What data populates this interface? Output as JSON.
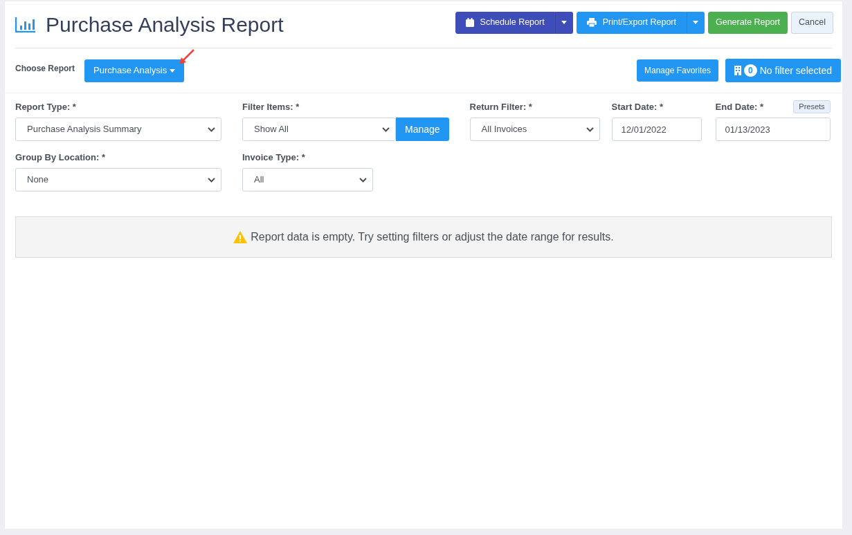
{
  "header": {
    "title": "Purchase Analysis Report",
    "buttons": [
      {
        "label": "Schedule Report",
        "kind": "split"
      },
      {
        "label": "Print/Export Report",
        "kind": "split"
      },
      {
        "label": "Generate Report",
        "kind": "plain"
      },
      {
        "label": "Cancel",
        "kind": "plain"
      }
    ]
  },
  "chooser": {
    "label": "Choose Report",
    "value": "Purchase Analysis",
    "favorites": "Manage Favorites",
    "filter_count": "0",
    "filter_label": "No filter selected"
  },
  "form_rows": [
    [
      {
        "label": "Report Type: *",
        "kind": "select",
        "value": "Purchase Analysis Summary"
      },
      {
        "label": "Filter Items: *",
        "kind": "select",
        "value": "Show All",
        "action": "Manage"
      },
      {
        "label": "Return Filter: *",
        "kind": "select",
        "value": "All Invoices"
      },
      {
        "label": "Start Date: *",
        "kind": "date",
        "value": "12/01/2022"
      },
      {
        "label": "End Date: *",
        "kind": "date",
        "value": "01/13/2023",
        "extra": "Presets"
      }
    ],
    [
      {
        "label": "Group By Location: *",
        "kind": "select",
        "value": "None"
      },
      {
        "label": "Invoice Type: *",
        "kind": "select",
        "value": "All"
      }
    ]
  ],
  "alert": "Report data is empty. Try setting filters or adjust the date range for results."
}
